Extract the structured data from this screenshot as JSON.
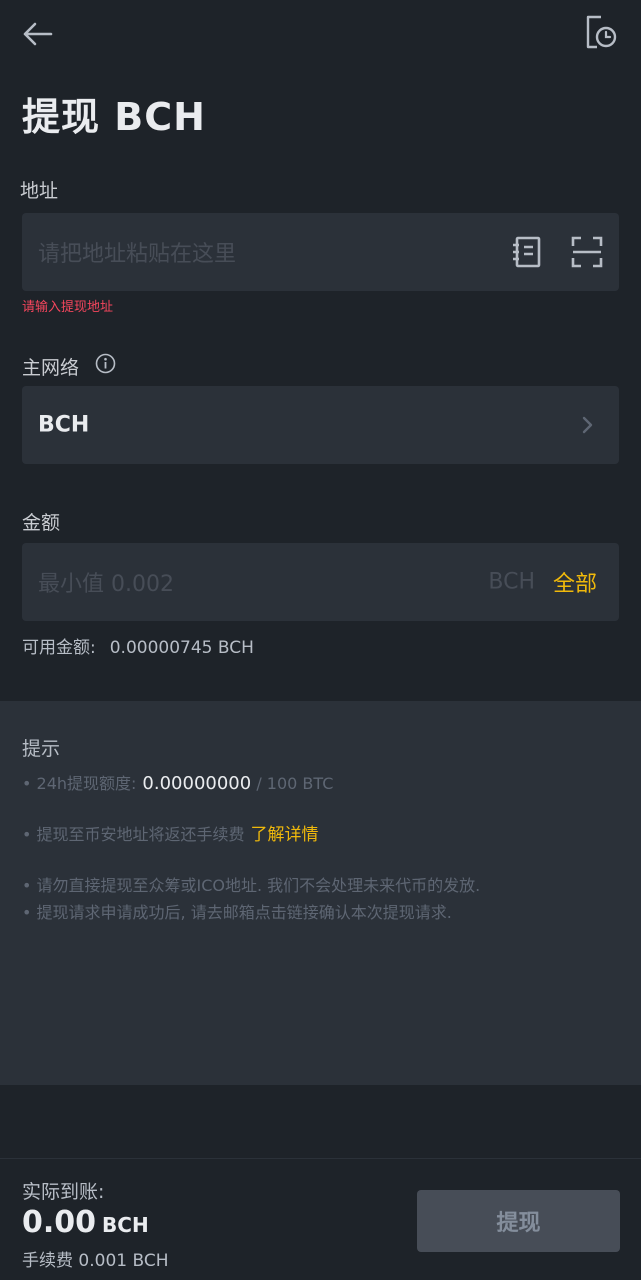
{
  "header": {
    "back_icon": "arrow-left-icon",
    "history_icon": "history-record-icon"
  },
  "page_title": "提现 BCH",
  "address": {
    "label": "地址",
    "placeholder": "请把地址粘贴在这里",
    "address_book_icon": "address-book-icon",
    "scan_icon": "scan-icon",
    "error": "请输入提现地址"
  },
  "network": {
    "label": "主网络",
    "info_icon": "info-icon",
    "value": "BCH",
    "chevron_icon": "chevron-right-icon"
  },
  "amount": {
    "label": "金额",
    "placeholder": "最小值 0.002",
    "unit": "BCH",
    "all_label": "全部",
    "available_label": "可用金额:",
    "available_value": "0.00000745 BCH"
  },
  "tips": {
    "title": "提示",
    "limit_label": "• 24h提现额度:",
    "limit_used": "0.00000000",
    "limit_total": "/ 100 BTC",
    "refund_text": "• 提现至币安地址将返还手续费",
    "refund_link": "了解详情",
    "warning_1": "• 请勿直接提现至众筹或ICO地址. 我们不会处理未来代币的发放.",
    "warning_2": "• 提现请求申请成功后, 请去邮箱点击链接确认本次提现请求."
  },
  "footer": {
    "received_label": "实际到账:",
    "received_amount": "0.00",
    "received_unit": "BCH",
    "fee": "手续费 0.001 BCH",
    "submit_label": "提现"
  },
  "colors": {
    "background": "#1e2329",
    "panel": "#2b3139",
    "accent": "#f0b90b",
    "error": "#f6465d",
    "disabled_button": "#474d57"
  }
}
